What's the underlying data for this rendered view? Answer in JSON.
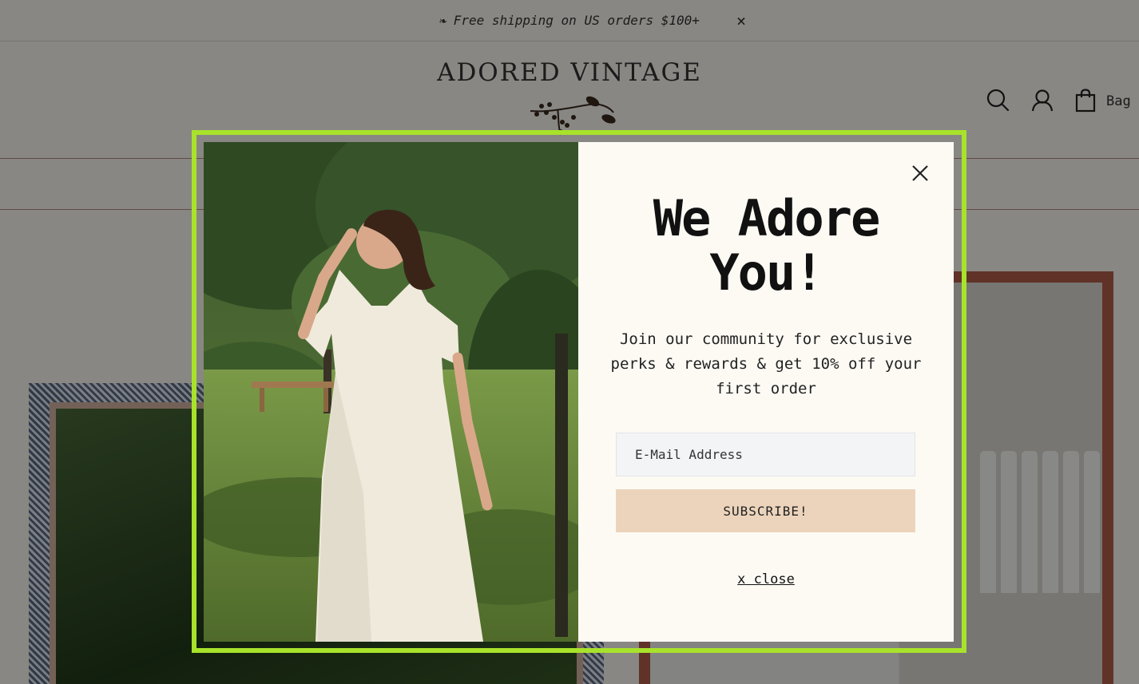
{
  "announcement": {
    "text": "Free shipping on US orders $100+",
    "leaf_glyph": "❧",
    "close_glyph": "×"
  },
  "header": {
    "logo": "ADORED VINTAGE",
    "bag_label": "Bag",
    "icons": [
      "search-icon",
      "account-icon",
      "bag-icon"
    ]
  },
  "popup": {
    "headline_line1": "We Adore",
    "headline_line2": "You!",
    "subtitle": "Join our community for exclusive perks & rewards & get 10% off your first order",
    "email_placeholder": "E-Mail Address",
    "subscribe_label": "SUBSCRIBE!",
    "close_link": "x close",
    "close_icon": "close-icon"
  },
  "colors": {
    "accent_border": "#a8e22b",
    "subscribe_bg": "#ecd4bc",
    "panel_bg": "#fdfaf4",
    "rule_color": "#b98b7c"
  }
}
